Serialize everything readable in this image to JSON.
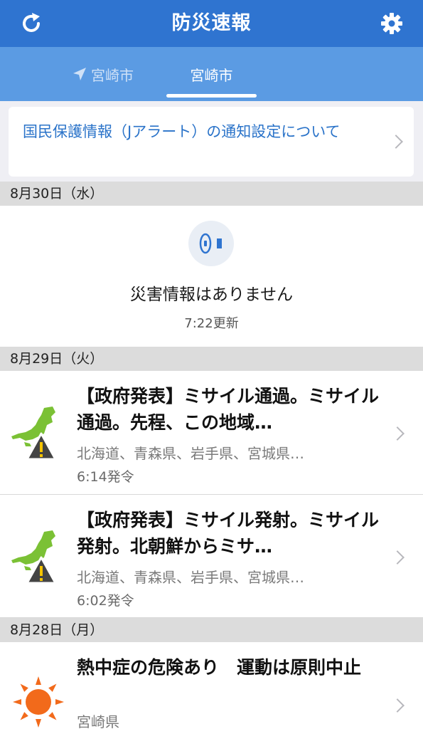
{
  "header": {
    "title": "防災速報",
    "refresh_icon": "refresh-icon",
    "settings_icon": "gear-icon",
    "background": "#2f74d0"
  },
  "tabs": [
    {
      "label": "宮崎市",
      "icon": "location-arrow-icon",
      "active": false
    },
    {
      "label": "宮崎市",
      "active": true
    }
  ],
  "notice": {
    "text": "国民保護情報（Jアラート）の通知設定について",
    "link_color": "#2a73c9"
  },
  "sections": [
    {
      "date": "8月30日（水）",
      "empty": {
        "message": "災害情報はありません",
        "updated": "7:22更新",
        "icon": "megaphone-icon"
      }
    },
    {
      "date": "8月29日（火）",
      "alerts": [
        {
          "title": "【政府発表】ミサイル通過。ミサイル通過。先程、この地域…",
          "areas": "北海道、青森県、岩手県、宮城県…",
          "time": "6:14発令",
          "icon": "japan-map-warning-icon"
        },
        {
          "title": "【政府発表】ミサイル発射。ミサイル発射。北朝鮮からミサ…",
          "areas": "北海道、青森県、岩手県、宮城県…",
          "time": "6:02発令",
          "icon": "japan-map-warning-icon"
        }
      ]
    },
    {
      "date": "8月28日（月）",
      "alerts": [
        {
          "title": "熱中症の危険あり　運動は原則中止",
          "areas": "宮崎県",
          "icon": "sun-icon"
        }
      ]
    }
  ],
  "colors": {
    "accent": "#2f74d0",
    "tab_bar": "#5b9be3",
    "map_green": "#7bc135",
    "warning_dark": "#444444",
    "warning_yellow": "#f5c400",
    "sun_orange": "#f26a1b"
  }
}
